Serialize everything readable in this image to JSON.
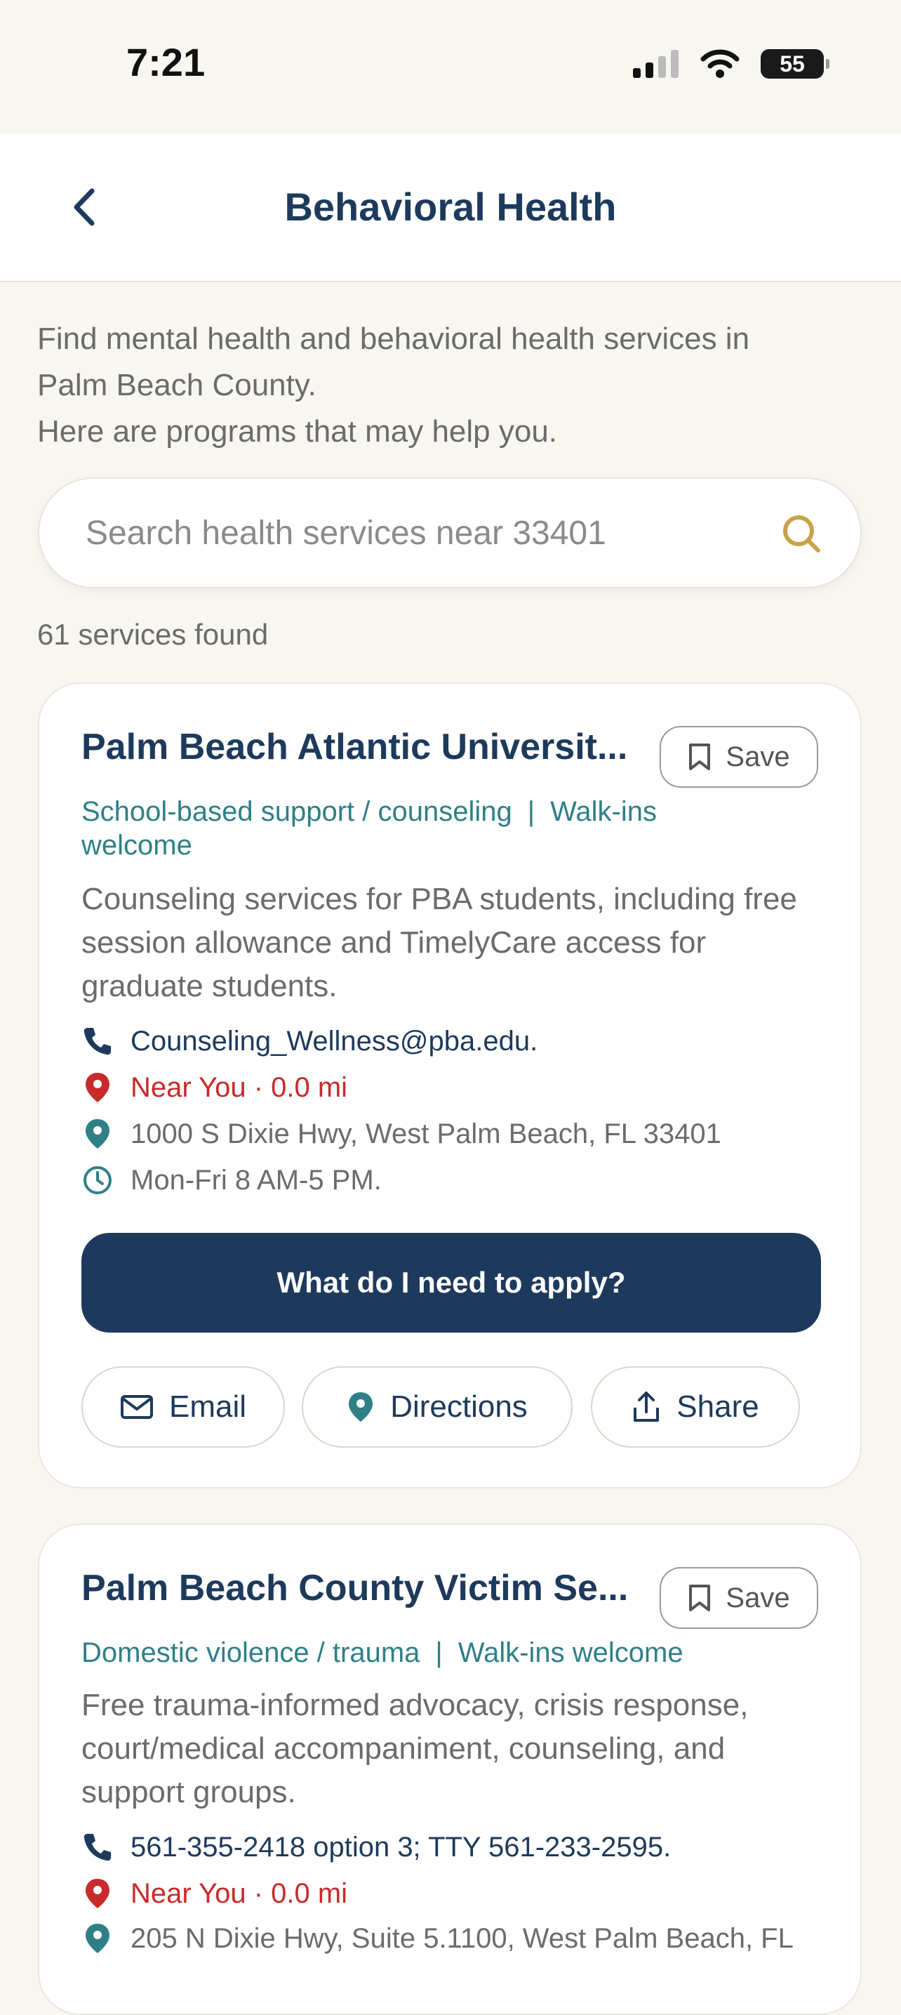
{
  "status": {
    "time": "7:21",
    "battery": "55"
  },
  "nav": {
    "title": "Behavioral Health"
  },
  "intro": {
    "line1": "Find mental health and behavioral health services in",
    "line2": "Palm Beach County.",
    "line3": "Here are programs that may help you."
  },
  "search": {
    "placeholder": "Search health services near 33401"
  },
  "results": {
    "count_label": "61 services found"
  },
  "cards": [
    {
      "title": "Palm Beach Atlantic Universit...",
      "save_label": "Save",
      "tag1": "School-based support / counseling",
      "tag_sep": "|",
      "tag2a": "Walk-ins",
      "tag2b": "welcome",
      "description_l1": "Counseling services for PBA students, including free",
      "description_l2": "session allowance and TimelyCare access for",
      "description_l3": "graduate students.",
      "contact": "Counseling_Wellness@pba.edu.",
      "distance": "Near You · 0.0 mi",
      "address": "1000 S Dixie Hwy, West Palm Beach, FL 33401",
      "hours": "Mon-Fri 8 AM-5 PM.",
      "apply_label": "What do I need to apply?",
      "actions": {
        "email": "Email",
        "directions": "Directions",
        "share": "Share"
      }
    },
    {
      "title": "Palm Beach County Victim Se...",
      "save_label": "Save",
      "tag1": "Domestic violence / trauma",
      "tag_sep": "|",
      "tag2": "Walk-ins welcome",
      "description_l1": "Free trauma-informed advocacy, crisis response,",
      "description_l2": "court/medical accompaniment, counseling, and",
      "description_l3": "support groups.",
      "contact": "561-355-2418 option 3; TTY 561-233-2595.",
      "distance": "Near You · 0.0 mi",
      "address": "205 N Dixie Hwy, Suite 5.1100, West Palm Beach, FL"
    }
  ],
  "colors": {
    "navy": "#1d3a5c",
    "teal": "#2f7f87",
    "red": "#c92a2a",
    "search_icon": "#c9a14a"
  }
}
